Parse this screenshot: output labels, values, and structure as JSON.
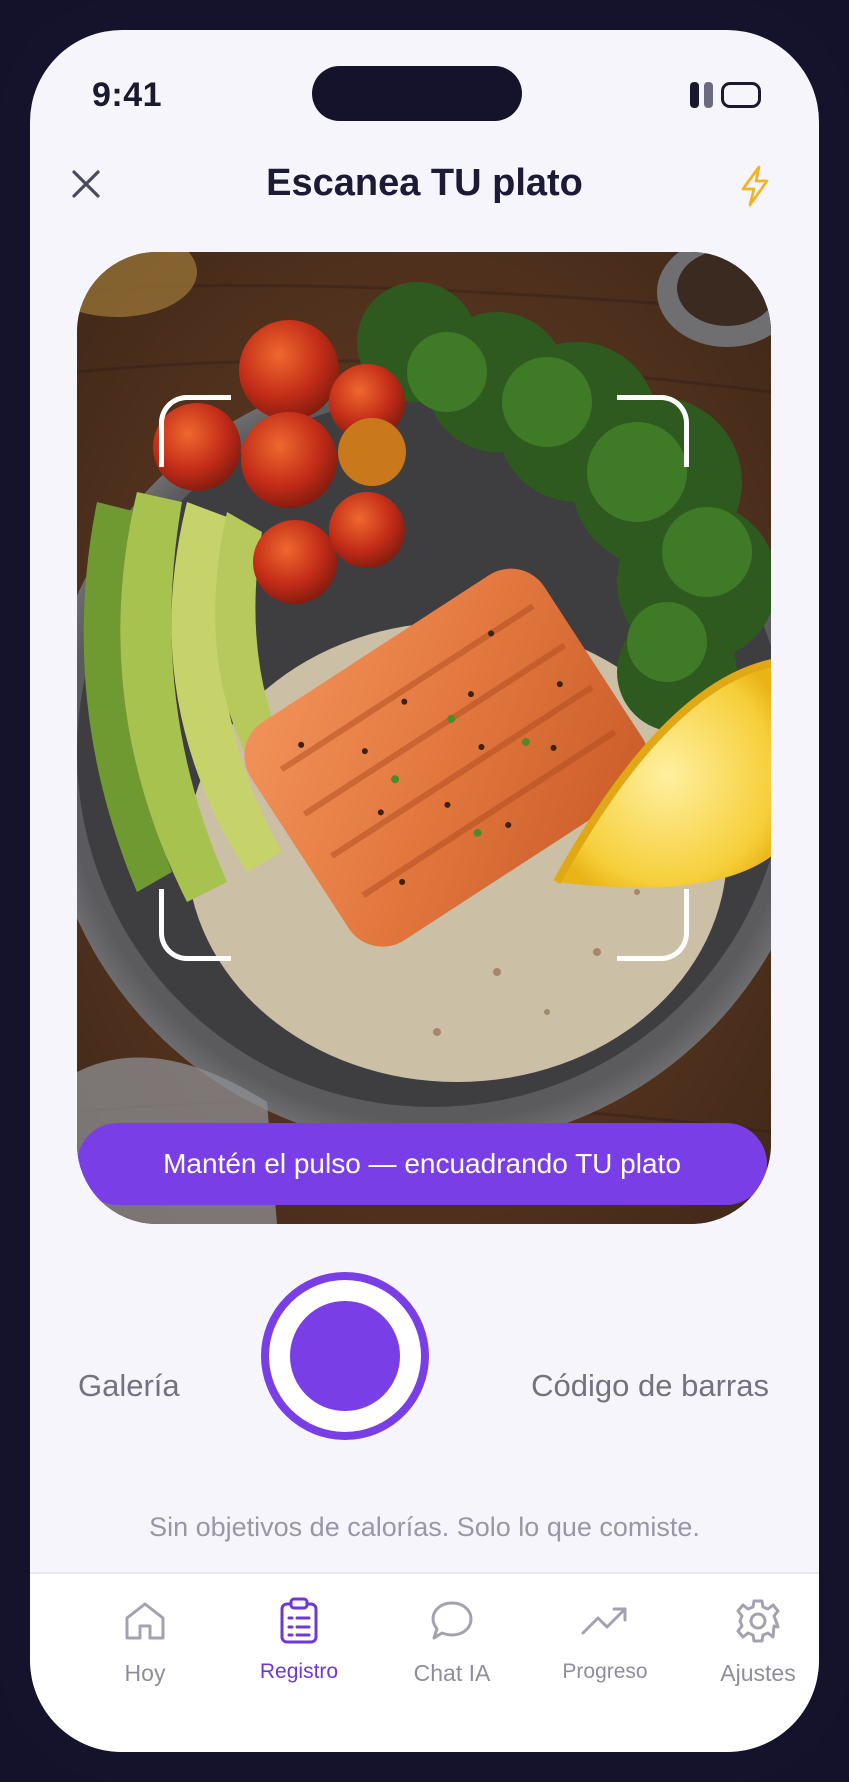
{
  "status_bar": {
    "time": "9:41"
  },
  "header": {
    "title": "Escanea TU plato",
    "close_icon": "close-icon",
    "flash_icon": "flash-icon"
  },
  "camera": {
    "banner_text": "Mantén el pulso — encuadrando TU plato"
  },
  "controls": {
    "gallery_label": "Galería",
    "barcode_label": "Código de barras",
    "shutter_icon": "shutter-button"
  },
  "tagline": "Sin objetivos de calorías. Solo lo que comiste.",
  "tabs": [
    {
      "label": "Hoy",
      "icon": "home-icon",
      "active": false
    },
    {
      "label": "Registro",
      "icon": "clipboard-icon",
      "active": true
    },
    {
      "label": "Chat IA",
      "icon": "chat-bubble-icon",
      "active": false
    },
    {
      "label": "Progreso",
      "icon": "trend-up-icon",
      "active": false
    },
    {
      "label": "Ajustes",
      "icon": "gear-icon",
      "active": false
    }
  ],
  "colors": {
    "accent": "#7a3ee6",
    "title": "#1c1a35",
    "muted_text": "#74727f",
    "flash": "#f0b42a"
  }
}
